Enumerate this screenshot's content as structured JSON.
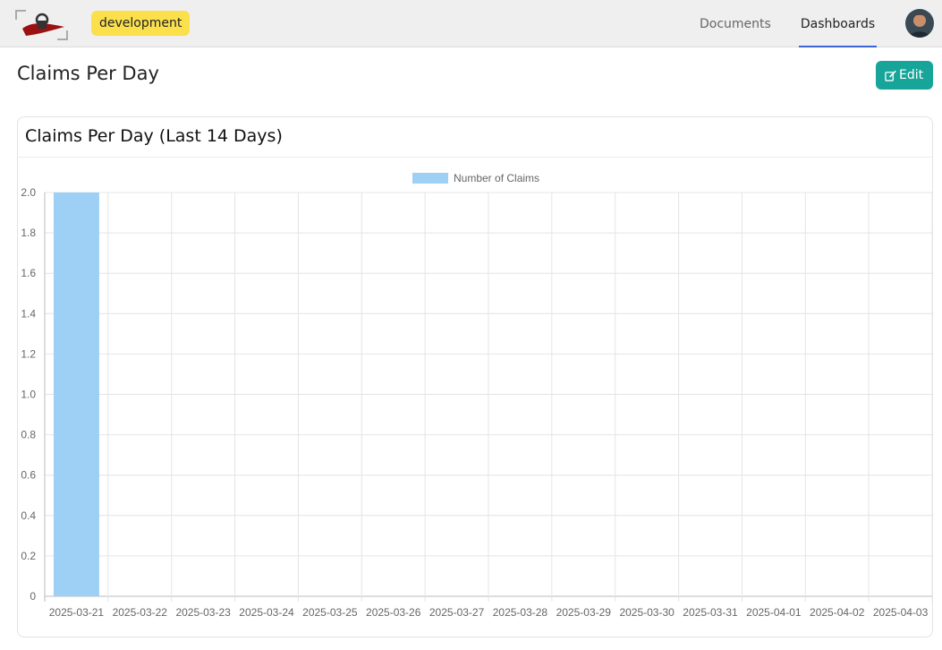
{
  "topbar": {
    "environment": "development",
    "nav": [
      {
        "label": "Documents",
        "active": false
      },
      {
        "label": "Dashboards",
        "active": true
      }
    ]
  },
  "page": {
    "title": "Claims Per Day",
    "edit_label": "Edit"
  },
  "colors": {
    "accent": "#17a59a",
    "badge": "#fbe04c",
    "nav_active": "#3b63d8",
    "bar": "#9ed0f5"
  },
  "chart_data": {
    "type": "bar",
    "title": "Claims Per Day (Last 14 Days)",
    "xlabel": "",
    "ylabel": "",
    "categories": [
      "2025-03-21",
      "2025-03-22",
      "2025-03-23",
      "2025-03-24",
      "2025-03-25",
      "2025-03-26",
      "2025-03-27",
      "2025-03-28",
      "2025-03-29",
      "2025-03-30",
      "2025-03-31",
      "2025-04-01",
      "2025-04-02",
      "2025-04-03"
    ],
    "series": [
      {
        "name": "Number of Claims",
        "values": [
          2,
          0,
          0,
          0,
          0,
          0,
          0,
          0,
          0,
          0,
          0,
          0,
          0,
          0
        ]
      }
    ],
    "ylim": [
      0,
      2.0
    ],
    "yticks": [
      "0",
      "0.2",
      "0.4",
      "0.6",
      "0.8",
      "1.0",
      "1.2",
      "1.4",
      "1.6",
      "1.8",
      "2.0"
    ],
    "grid": true,
    "legend": "top-center"
  }
}
